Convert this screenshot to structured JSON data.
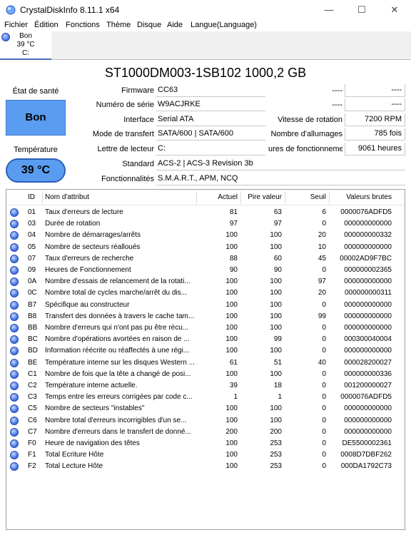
{
  "window": {
    "title": "CrystalDiskInfo 8.11.1 x64",
    "minimize": "—",
    "maximize": "☐",
    "close": "✕"
  },
  "menu": [
    "Fichier",
    "Édition",
    "Fonctions",
    "Thème",
    "Disque",
    "Aide",
    "Langue(Language)"
  ],
  "disk_tab": {
    "status": "Bon",
    "temp": "39 °C",
    "letter": "C:"
  },
  "drive_title": "ST1000DM003-1SB102 1000,2 GB",
  "health": {
    "label": "État de santé",
    "value": "Bon",
    "color": "#5a9cf0"
  },
  "temperature": {
    "label": "Température",
    "value": "39 °C"
  },
  "info": {
    "firmware_label": "Firmware",
    "firmware": "CC63",
    "serial_label": "Numéro de série",
    "serial": "W9ACJRKE",
    "interface_label": "Interface",
    "interface": "Serial ATA",
    "transfer_label": "Mode de transfert",
    "transfer": "SATA/600 | SATA/600",
    "drive_letter_label": "Lettre de lecteur",
    "drive_letter": "C:",
    "standard_label": "Standard",
    "standard": "ACS-2 | ACS-3 Revision 3b",
    "features_label": "Fonctionnalités",
    "features": "S.M.A.R.T., APM, NCQ",
    "r1_label": "----",
    "r1_value": "----",
    "r2_label": "----",
    "r2_value": "----",
    "rotation_label": "Vitesse de rotation",
    "rotation": "7200 RPM",
    "power_count_label": "Nombre d'allumages",
    "power_count": "785 fois",
    "power_hours_label": "ures de fonctionnement",
    "power_hours": "9061 heures"
  },
  "smart": {
    "headers": {
      "id": "ID",
      "name": "Nom d'attribut",
      "current": "Actuel",
      "worst": "Pire valeur",
      "threshold": "Seuil",
      "raw": "Valeurs brutes"
    },
    "rows": [
      {
        "id": "01",
        "name": "Taux d'erreurs de lecture",
        "current": "81",
        "worst": "63",
        "threshold": "6",
        "raw": "0000076ADFD5"
      },
      {
        "id": "03",
        "name": "Durée de rotation",
        "current": "97",
        "worst": "97",
        "threshold": "0",
        "raw": "000000000000"
      },
      {
        "id": "04",
        "name": "Nombre de démarrages/arrêts",
        "current": "100",
        "worst": "100",
        "threshold": "20",
        "raw": "000000000332"
      },
      {
        "id": "05",
        "name": "Nombre de secteurs réalloués",
        "current": "100",
        "worst": "100",
        "threshold": "10",
        "raw": "000000000000"
      },
      {
        "id": "07",
        "name": "Taux d'erreurs de recherche",
        "current": "88",
        "worst": "60",
        "threshold": "45",
        "raw": "00002AD9F7BC"
      },
      {
        "id": "09",
        "name": "Heures de Fonctionnement",
        "current": "90",
        "worst": "90",
        "threshold": "0",
        "raw": "000000002365"
      },
      {
        "id": "0A",
        "name": "Nombre d'essais de relancement de la rotati...",
        "current": "100",
        "worst": "100",
        "threshold": "97",
        "raw": "000000000000"
      },
      {
        "id": "0C",
        "name": "Nombre total de cycles marche/arrêt du dis...",
        "current": "100",
        "worst": "100",
        "threshold": "20",
        "raw": "000000000311"
      },
      {
        "id": "B7",
        "name": "Spécifique au constructeur",
        "current": "100",
        "worst": "100",
        "threshold": "0",
        "raw": "000000000000"
      },
      {
        "id": "B8",
        "name": "Transfert des données à travers le cache tam...",
        "current": "100",
        "worst": "100",
        "threshold": "99",
        "raw": "000000000000"
      },
      {
        "id": "BB",
        "name": "Nombre d'erreurs qui n'ont pas pu être récu...",
        "current": "100",
        "worst": "100",
        "threshold": "0",
        "raw": "000000000000"
      },
      {
        "id": "BC",
        "name": "Nombre d'opérations avortées en raison de ...",
        "current": "100",
        "worst": "99",
        "threshold": "0",
        "raw": "000300040004"
      },
      {
        "id": "BD",
        "name": "Information réécrite ou réaffectés à une régi...",
        "current": "100",
        "worst": "100",
        "threshold": "0",
        "raw": "000000000000"
      },
      {
        "id": "BE",
        "name": "Température interne sur les disques Western ...",
        "current": "61",
        "worst": "51",
        "threshold": "40",
        "raw": "000028200027"
      },
      {
        "id": "C1",
        "name": "Nombre de fois que la tête a changé de posi...",
        "current": "100",
        "worst": "100",
        "threshold": "0",
        "raw": "000000000336"
      },
      {
        "id": "C2",
        "name": "Température interne actuelle.",
        "current": "39",
        "worst": "18",
        "threshold": "0",
        "raw": "001200000027"
      },
      {
        "id": "C3",
        "name": "Temps entre les erreurs corrigées par code c...",
        "current": "1",
        "worst": "1",
        "threshold": "0",
        "raw": "0000076ADFD5"
      },
      {
        "id": "C5",
        "name": "Nombre de secteurs \"instables\"",
        "current": "100",
        "worst": "100",
        "threshold": "0",
        "raw": "000000000000"
      },
      {
        "id": "C6",
        "name": "Nombre total d'erreurs incorrigibles d'un se...",
        "current": "100",
        "worst": "100",
        "threshold": "0",
        "raw": "000000000000"
      },
      {
        "id": "C7",
        "name": "Nombre d'erreurs dans le transfert de donné...",
        "current": "200",
        "worst": "200",
        "threshold": "0",
        "raw": "000000000000"
      },
      {
        "id": "F0",
        "name": "Heure de navigation des têtes",
        "current": "100",
        "worst": "253",
        "threshold": "0",
        "raw": "DE5500002361"
      },
      {
        "id": "F1",
        "name": "Total Ecriture Hôte",
        "current": "100",
        "worst": "253",
        "threshold": "0",
        "raw": "0008D7DBF262"
      },
      {
        "id": "F2",
        "name": "Total Lecture Hôte",
        "current": "100",
        "worst": "253",
        "threshold": "0",
        "raw": "000DA1792C73"
      }
    ]
  }
}
